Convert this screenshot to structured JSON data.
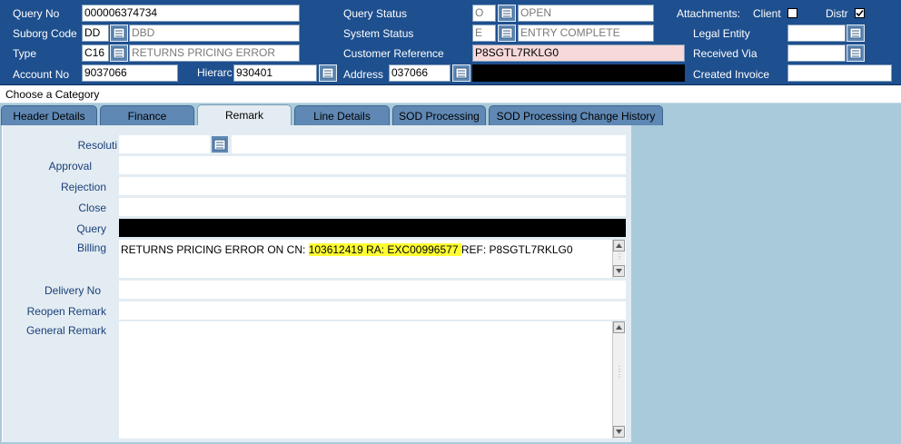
{
  "header": {
    "query_no_label": "Query No",
    "query_no_value": "000006374734",
    "suborg_label": "Suborg Code",
    "suborg_code": "DD",
    "suborg_desc": "DBD",
    "type_label": "Type",
    "type_code": "C16",
    "type_desc": "RETURNS PRICING ERROR",
    "account_label": "Account No",
    "account_value": "9037066",
    "hierarchy_label": "Hierarc",
    "hierarchy_value": "930401",
    "query_status_label": "Query Status",
    "query_status_code": "O",
    "query_status_desc": "OPEN",
    "system_status_label": "System Status",
    "system_status_code": "E",
    "system_status_desc": "ENTRY COMPLETE",
    "customer_ref_label": "Customer Reference",
    "customer_ref_value": "P8SGTL7RKLG0",
    "address_label": "Address",
    "address_code": "037066",
    "attachments_label": "Attachments:",
    "client_label": "Client",
    "distr_label": "Distr",
    "legal_entity_label": "Legal Entity",
    "received_via_label": "Received Via",
    "created_invoice_label": "Created Invoice",
    "client_checked": false,
    "distr_checked": true
  },
  "category_bar": {
    "text": "Choose a Category"
  },
  "tabs": [
    {
      "label": "Header Details",
      "active": false
    },
    {
      "label": "Finance",
      "active": false
    },
    {
      "label": "Remark",
      "active": true
    },
    {
      "label": "Line Details",
      "active": false
    },
    {
      "label": "SOD Processing",
      "active": false
    },
    {
      "label": "SOD Processing Change History",
      "active": false
    }
  ],
  "remark": {
    "resolution_label": "Resoluti",
    "approval_label": "Approval",
    "rejection_label": "Rejection",
    "close_label": "Close",
    "query_label": "Query",
    "billing_label": "Billing",
    "billing_text_before": "RETURNS PRICING ERROR ON CN: ",
    "billing_text_highlight": "103612419 RA: EXC00996577 ",
    "billing_text_after": "REF: P8SGTL7RKLG0",
    "delivery_label": "Delivery No",
    "reopen_label": "Reopen Remark",
    "general_label": "General Remark"
  },
  "colors": {
    "header_bg": "#1e4f8e",
    "panel_bg": "#a9cadb",
    "active_tab_bg": "#e3ecf2",
    "highlight": "#ffff33",
    "customer_ref_bg": "#f7d9d9"
  }
}
